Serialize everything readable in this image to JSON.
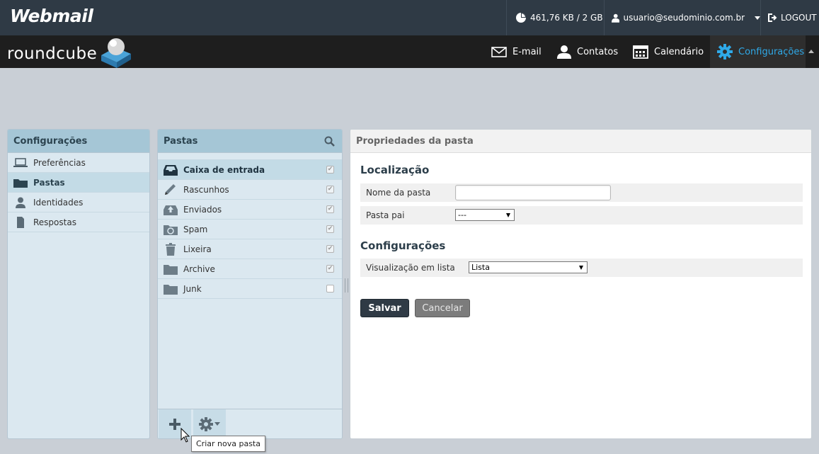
{
  "header": {
    "brand": "Webmail",
    "quota": "461,76 KB / 2 GB",
    "user": "usuario@seudominio.com.br",
    "logout": "LOGOUT"
  },
  "navbar": {
    "logo_text": "roundcube",
    "items": [
      {
        "label": "E-mail",
        "icon": "envelope-icon"
      },
      {
        "label": "Contatos",
        "icon": "person-icon"
      },
      {
        "label": "Calendário",
        "icon": "calendar-icon"
      },
      {
        "label": "Configurações",
        "icon": "gear-icon",
        "active": true
      }
    ],
    "accent": "#2fa9e8"
  },
  "settings_panel": {
    "title": "Configurações",
    "items": [
      {
        "label": "Preferências",
        "icon": "laptop-icon"
      },
      {
        "label": "Pastas",
        "icon": "folder-icon",
        "active": true
      },
      {
        "label": "Identidades",
        "icon": "person-icon"
      },
      {
        "label": "Respostas",
        "icon": "document-icon"
      }
    ]
  },
  "folders_panel": {
    "title": "Pastas",
    "items": [
      {
        "label": "Caixa de entrada",
        "icon": "inbox-icon",
        "subscribed": true,
        "selected": true
      },
      {
        "label": "Rascunhos",
        "icon": "pencil-icon",
        "subscribed": true
      },
      {
        "label": "Enviados",
        "icon": "sent-icon",
        "subscribed": true
      },
      {
        "label": "Spam",
        "icon": "spam-icon",
        "subscribed": true
      },
      {
        "label": "Lixeira",
        "icon": "trash-icon",
        "subscribed": true
      },
      {
        "label": "Archive",
        "icon": "folder-icon",
        "subscribed": true
      },
      {
        "label": "Junk",
        "icon": "folder-icon",
        "subscribed": false
      }
    ],
    "tooltip": "Criar nova pasta"
  },
  "properties_panel": {
    "title": "Propriedades da pasta",
    "location_title": "Localização",
    "folder_name_label": "Nome da pasta",
    "folder_name_value": "",
    "parent_label": "Pasta pai",
    "parent_value": "---",
    "settings_title": "Configurações",
    "list_view_label": "Visualização em lista",
    "list_view_value": "Lista",
    "save_label": "Salvar",
    "cancel_label": "Cancelar"
  }
}
